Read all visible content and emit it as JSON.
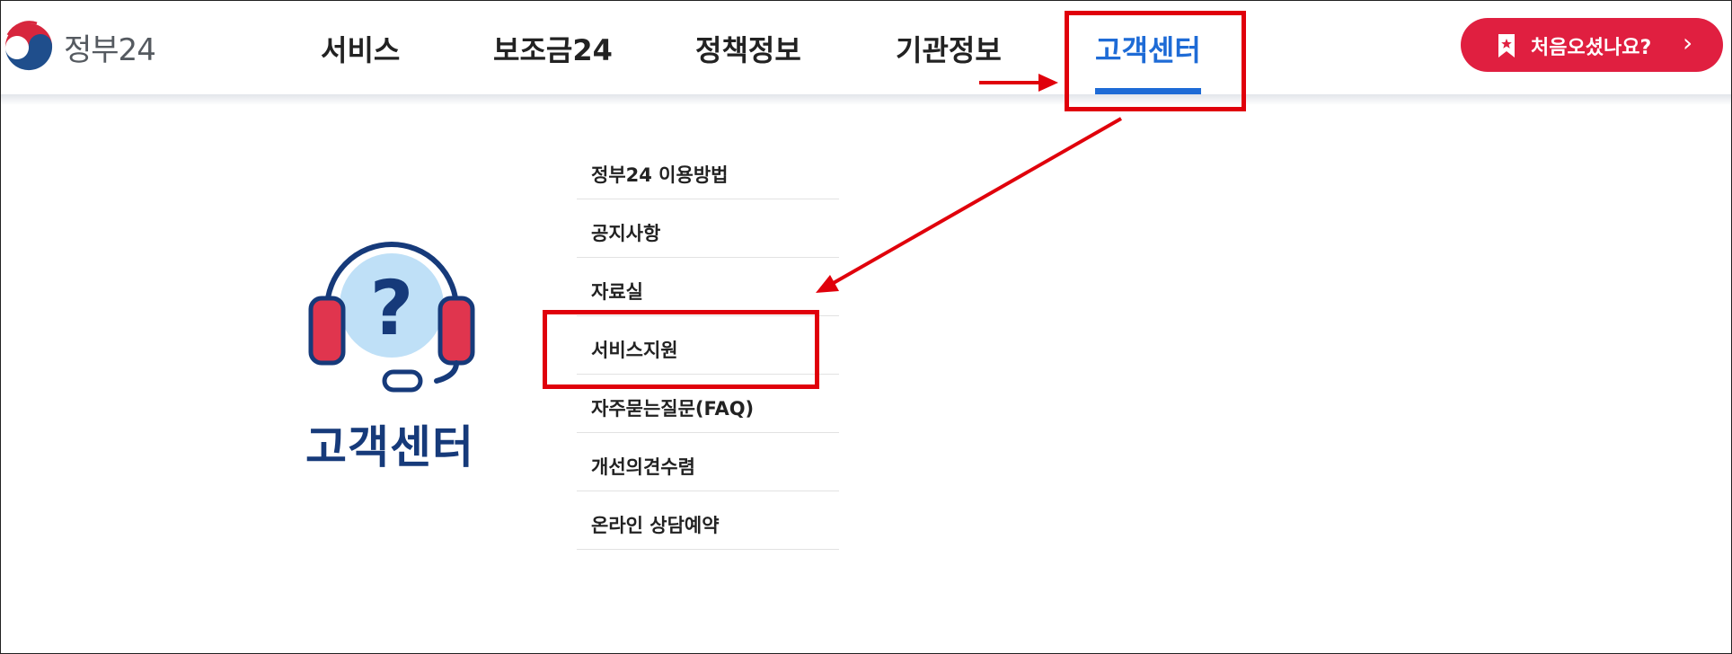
{
  "header": {
    "logo_text": "정부24",
    "nav": [
      {
        "label": "서비스"
      },
      {
        "label": "보조금24"
      },
      {
        "label": "정책정보"
      },
      {
        "label": "기관정보"
      },
      {
        "label": "고객센터",
        "active": true
      }
    ],
    "first_visit_button": "처음오셨나요?",
    "chevron": "›"
  },
  "left_panel": {
    "icon": "headset-question-icon",
    "title": "고객센터"
  },
  "menu": {
    "items": [
      {
        "label": "정부24 이용방법"
      },
      {
        "label": "공지사항"
      },
      {
        "label": "자료실"
      },
      {
        "label": "서비스지원",
        "highlighted": true
      },
      {
        "label": "자주묻는질문(FAQ)"
      },
      {
        "label": "개선의견수렴"
      },
      {
        "label": "온라인 상담예약"
      }
    ]
  },
  "colors": {
    "accent_blue": "#1e6bd6",
    "brand_red": "#e01f40",
    "title_navy": "#163a7a",
    "annotation_red": "#e0000b"
  }
}
